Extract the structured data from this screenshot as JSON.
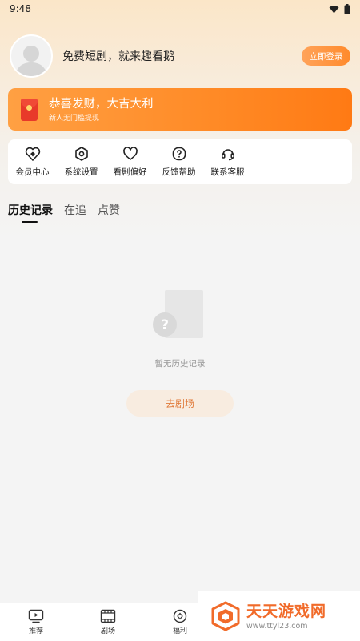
{
  "status": {
    "time": "9:48"
  },
  "profile": {
    "prompt_text": "免费短剧，就来趣看鹅",
    "login_label": "立即登录"
  },
  "banner": {
    "title": "恭喜发财，大吉大利",
    "subtitle": "新人无门槛提现"
  },
  "menu": {
    "items": [
      {
        "label": "会员中心",
        "icon": "heart-diamond-icon"
      },
      {
        "label": "系统设置",
        "icon": "hexagon-gear-icon"
      },
      {
        "label": "看剧偏好",
        "icon": "heart-icon"
      },
      {
        "label": "反馈帮助",
        "icon": "question-icon"
      },
      {
        "label": "联系客服",
        "icon": "headset-icon"
      }
    ]
  },
  "tabs": [
    {
      "label": "历史记录",
      "active": true
    },
    {
      "label": "在追",
      "active": false
    },
    {
      "label": "点赞",
      "active": false
    }
  ],
  "empty_state": {
    "message": "暂无历史记录",
    "action_label": "去剧场"
  },
  "bottom_nav": [
    {
      "label": "推荐",
      "icon": "play-screen-icon"
    },
    {
      "label": "剧场",
      "icon": "film-icon"
    },
    {
      "label": "福利",
      "icon": "coin-icon"
    }
  ],
  "watermark": {
    "title": "天天游戏网",
    "url": "www.ttyl23.com"
  },
  "colors": {
    "accent": "#ff8a26",
    "banner_end": "#ff7a14",
    "action_text": "#e07a3a",
    "watermark": "#f16b2a"
  }
}
